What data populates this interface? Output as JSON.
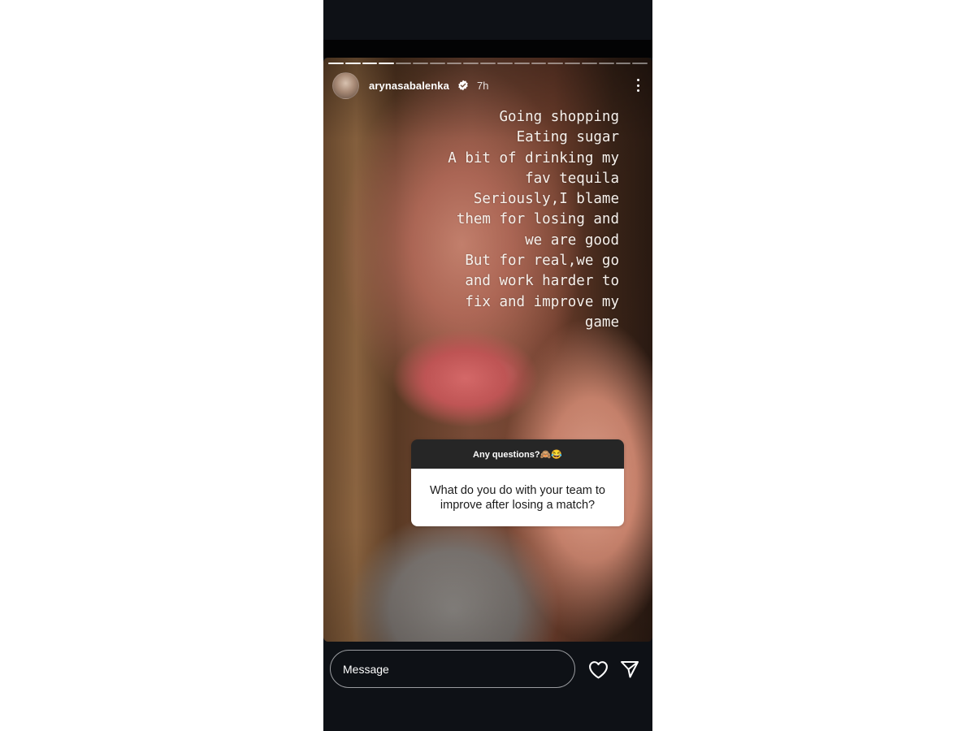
{
  "story": {
    "progress": {
      "total_segments": 19,
      "completed_segments": 4
    },
    "header": {
      "avatar_icon": "profile-avatar",
      "username": "arynasabalenka",
      "verified_icon": "verified-badge-icon",
      "time_ago": "7h",
      "more_icon": "more-vertical-icon"
    },
    "caption_text": "Going shopping\nEating sugar\nA bit of drinking my\nfav tequila\nSeriously,I blame\nthem for losing and\nwe are good\nBut for real,we go\nand work harder to\nfix and improve my\ngame",
    "question_sticker": {
      "prompt": "Any questions?🙈😂",
      "question": "What do you do with your team to improve after losing a match?"
    }
  },
  "footer": {
    "message_placeholder": "Message",
    "like_icon": "heart-icon",
    "share_icon": "send-icon"
  },
  "colors": {
    "background": "#0e1116",
    "sticker_header": "#262626",
    "sticker_body": "#ffffff",
    "text_white": "#ffffff"
  }
}
